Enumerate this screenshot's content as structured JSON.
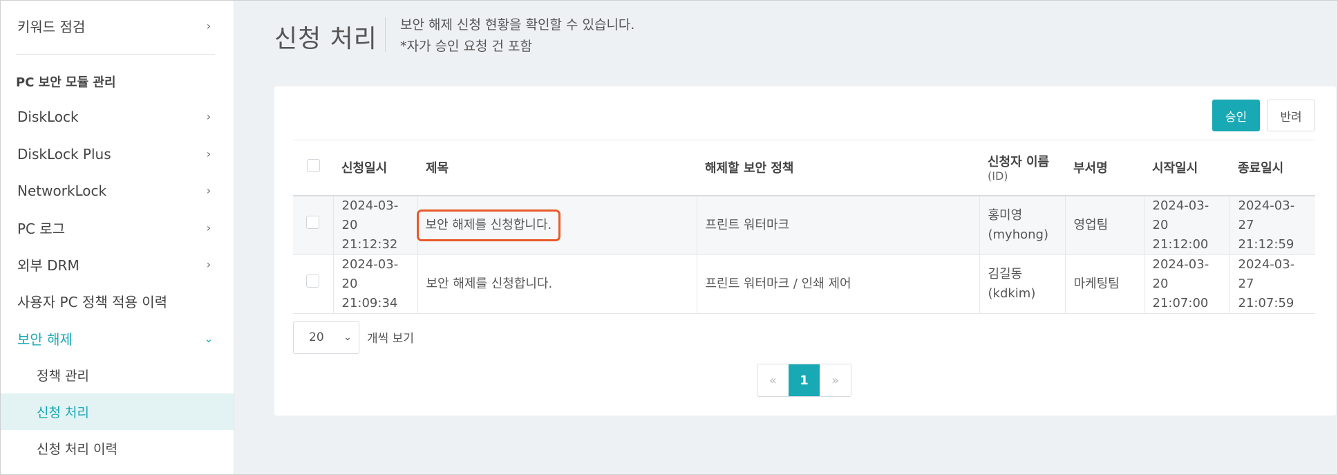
{
  "sidebar": {
    "items": [
      {
        "label": "키워드 점검"
      },
      {
        "label": "DiskLock"
      },
      {
        "label": "DiskLock Plus"
      },
      {
        "label": "NetworkLock"
      },
      {
        "label": "PC 로그"
      },
      {
        "label": "외부 DRM"
      },
      {
        "label": "사용자 PC 정책 적용 이력"
      },
      {
        "label": "보안 해제"
      },
      {
        "label": "정책 관리"
      },
      {
        "label": "신청 처리"
      },
      {
        "label": "신청 처리 이력"
      }
    ],
    "section_label": "PC 보안 모듈 관리",
    "chevron_right": "›",
    "chevron_down": "⌄"
  },
  "header": {
    "title": "신청 처리",
    "desc_line1": "보안 해제 신청 현황을 확인할 수 있습니다.",
    "desc_line2": "*자가 승인 요청 건 포함"
  },
  "actions": {
    "approve_label": "승인",
    "reject_label": "반려"
  },
  "table": {
    "columns": {
      "requested_at": "신청일시",
      "title": "제목",
      "policy": "해제할 보안 정책",
      "requester": "신청자 이름",
      "requester_sub": "(ID)",
      "department": "부서명",
      "start": "시작일시",
      "end": "종료일시"
    },
    "rows": [
      {
        "requested_date": "2024-03-20",
        "requested_time": "21:12:32",
        "title": "보안 해제를 신청합니다.",
        "policy": "프린트 워터마크",
        "name": "홍미영",
        "id": "(myhong)",
        "department": "영업팀",
        "start_date": "2024-03-20",
        "start_time": "21:12:00",
        "end_date": "2024-03-27",
        "end_time": "21:12:59"
      },
      {
        "requested_date": "2024-03-20",
        "requested_time": "21:09:34",
        "title": "보안 해제를 신청합니다.",
        "policy": "프린트 워터마크 / 인쇄 제어",
        "name": "김길동",
        "id": "(kdkim)",
        "department": "마케팅팀",
        "start_date": "2024-03-20",
        "start_time": "21:07:00",
        "end_date": "2024-03-27",
        "end_time": "21:07:59"
      }
    ]
  },
  "pagination": {
    "page_size": "20",
    "page_size_label": "개씩 보기",
    "prev": "«",
    "current": "1",
    "next": "»"
  },
  "colors": {
    "accent": "#19a9b4",
    "highlight_border": "#e85a2a",
    "background": "#eef1f4"
  }
}
